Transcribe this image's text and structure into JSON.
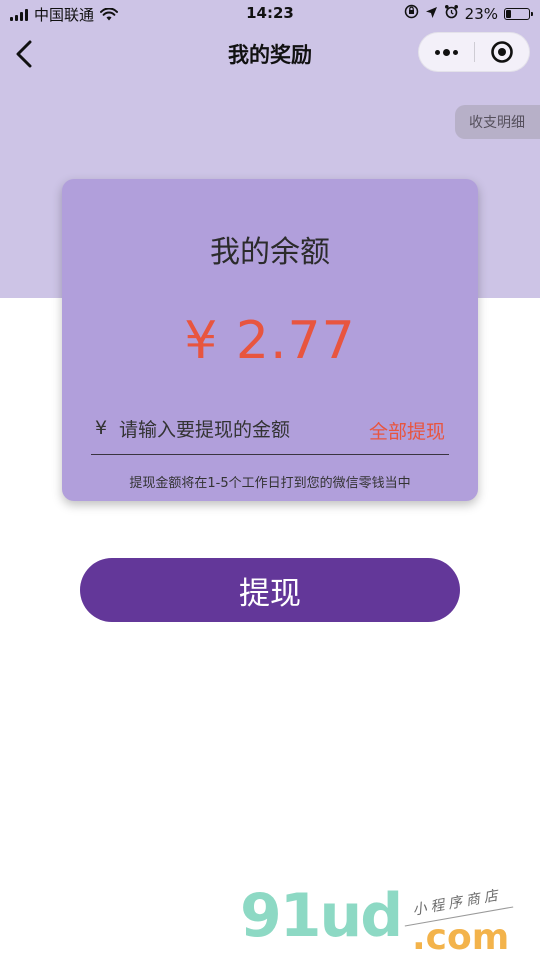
{
  "status_bar": {
    "carrier": "中国联通",
    "time": "14:23",
    "battery_percent": "23%",
    "battery_level": 0.23
  },
  "nav": {
    "title": "我的奖励"
  },
  "details_button": {
    "label": "收支明细"
  },
  "card": {
    "title": "我的余额",
    "balance": "¥ 2.77",
    "currency_sign": "¥",
    "amount_placeholder": "请输入要提现的金额",
    "withdraw_all_label": "全部提现",
    "note": "提现金额将在1-5个工作日打到您的微信零钱当中"
  },
  "withdraw_button": {
    "label": "提现"
  },
  "watermark": {
    "logo": "91ud",
    "domain": ".com",
    "tagline": "小程序商店"
  },
  "colors": {
    "header_bg": "#cdc4e6",
    "card_bg": "#b19fdb",
    "accent_red": "#e8553f",
    "button_purple": "#633799"
  }
}
